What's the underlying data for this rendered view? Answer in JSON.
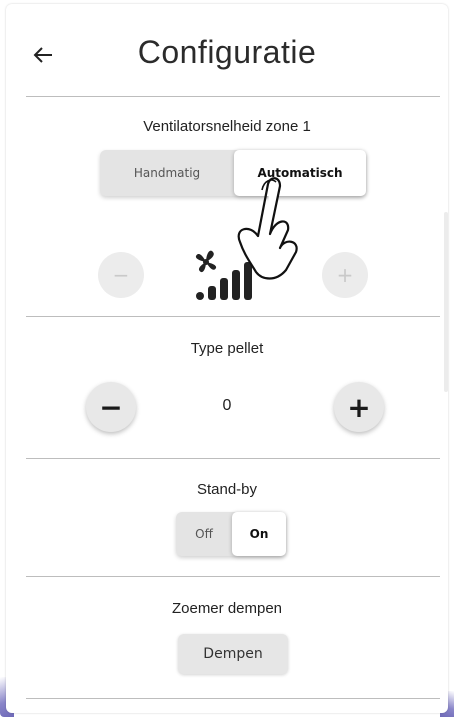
{
  "header": {
    "back_icon": "arrow-left-icon",
    "title": "Configuratie"
  },
  "fan_speed": {
    "title": "Ventilatorsnelheid zone 1",
    "options": [
      "Handmatig",
      "Automatisch"
    ],
    "selected": "Automatisch",
    "decrease_icon": "minus-icon",
    "increase_icon": "plus-icon",
    "level_icon": "fan-speed-icon"
  },
  "pellet_type": {
    "title": "Type pellet",
    "value": "0",
    "decrease_icon": "minus-icon",
    "increase_icon": "plus-icon"
  },
  "standby": {
    "title": "Stand-by",
    "options": [
      "Off",
      "On"
    ],
    "selected": "On"
  },
  "buzzer": {
    "title": "Zoemer dempen",
    "button_label": "Dempen"
  },
  "overlay": {
    "gesture_icon": "tap-hand-icon"
  },
  "colors": {
    "accent": "#6e69b8",
    "divider": "#bdbdbd",
    "button": "#e6e6e6"
  }
}
